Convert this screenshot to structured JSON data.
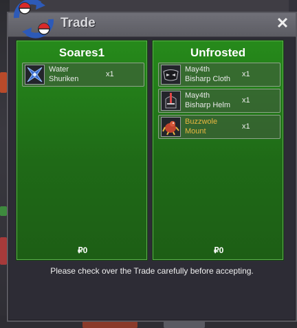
{
  "window": {
    "title": "Trade",
    "close_label": "✕",
    "footer_text": "Please check over the Trade carefully before accepting."
  },
  "left_panel": {
    "player": "Soares1",
    "items": [
      {
        "name_line1": "Water",
        "name_line2": "Shuriken",
        "qty": "x1",
        "icon": "water-shuriken-icon",
        "rare": false
      }
    ],
    "money": "₽0"
  },
  "right_panel": {
    "player": "Unfrosted",
    "items": [
      {
        "name_line1": "May4th",
        "name_line2": "Bisharp Cloth",
        "qty": "x1",
        "icon": "bisharp-cloth-icon",
        "rare": false
      },
      {
        "name_line1": "May4th",
        "name_line2": "Bisharp Helm",
        "qty": "x1",
        "icon": "bisharp-helm-icon",
        "rare": false
      },
      {
        "name_line1": "Buzzwole",
        "name_line2": "Mount",
        "qty": "x1",
        "icon": "buzzwole-mount-icon",
        "rare": true
      }
    ],
    "money": "₽0"
  },
  "colors": {
    "panel_green": "#238018",
    "rare_item": "#e8b640",
    "title_bar": "#66666d"
  }
}
